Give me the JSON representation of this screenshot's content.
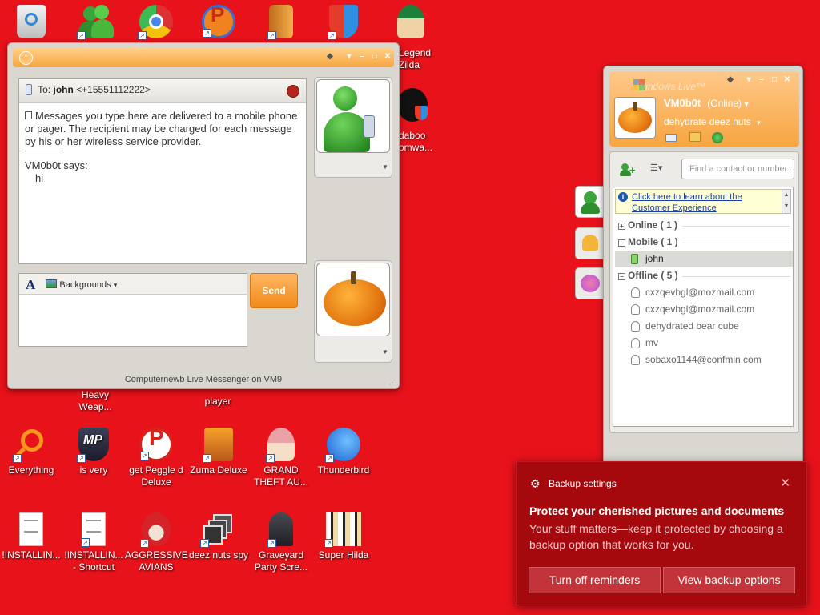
{
  "desktop": {
    "icons": [
      {
        "label": "Everything"
      },
      {
        "label": "is very"
      },
      {
        "label": "get Peggle d Deluxe"
      },
      {
        "label": "Zuma Deluxe"
      },
      {
        "label": "GRAND THEFT AU..."
      },
      {
        "label": "Thunderbird"
      },
      {
        "label": "!INSTALLIN..."
      },
      {
        "label": "!INSTALLIN... - Shortcut"
      },
      {
        "label": "AGGRESSIVE AVIANS"
      },
      {
        "label": "deez nuts spy"
      },
      {
        "label": "Graveyard Party Scre..."
      },
      {
        "label": "Super Hilda"
      }
    ],
    "partial_labels": {
      "legend": "Legend Zilda",
      "sdaboo": "daboo omwa...",
      "heavy": "Heavy Weap...",
      "player": "player"
    }
  },
  "chat_window": {
    "to_prefix": "To:",
    "to_name": "john",
    "to_number": "<+15551112222>",
    "notice": "Messages you type here are delivered to a mobile phone or pager. The recipient may be charged for each message by his or her wireless service provider.",
    "sender_line": "VM0b0t says:",
    "message": "hi",
    "backgrounds_label": "Backgrounds",
    "font_button": "A",
    "send_label": "Send",
    "footer": "Computernewb Live Messenger on VM9"
  },
  "messenger": {
    "title": "Windows Live™",
    "display_name": "VM0b0t",
    "status": "(Online)",
    "personal_message": "dehydrate deez nuts",
    "search_placeholder": "Find a contact or number...",
    "info_banner": "Click here to learn about the Customer Experience",
    "groups": {
      "online": "Online ( 1 )",
      "mobile": "Mobile ( 1 )",
      "offline": "Offline ( 5 )"
    },
    "contacts": {
      "mobile": [
        "john"
      ],
      "offline": [
        "cxzqevbgl@mozmail.com",
        "cxzqevbgl@mozmail.com",
        "dehydrated bear cube",
        "mv",
        "sobaxo1144@confmin.com"
      ]
    }
  },
  "toast": {
    "app_name": "Backup settings",
    "title": "Protect your cherished pictures and documents",
    "body": "Your stuff matters—keep it protected by choosing a backup option that works for you.",
    "btn_dismiss": "Turn off reminders",
    "btn_action": "View backup options"
  },
  "colors": {
    "desktop_bg": "#e8121a",
    "messenger_accent": "#f7a540",
    "toast_bg": "#a5080d"
  }
}
